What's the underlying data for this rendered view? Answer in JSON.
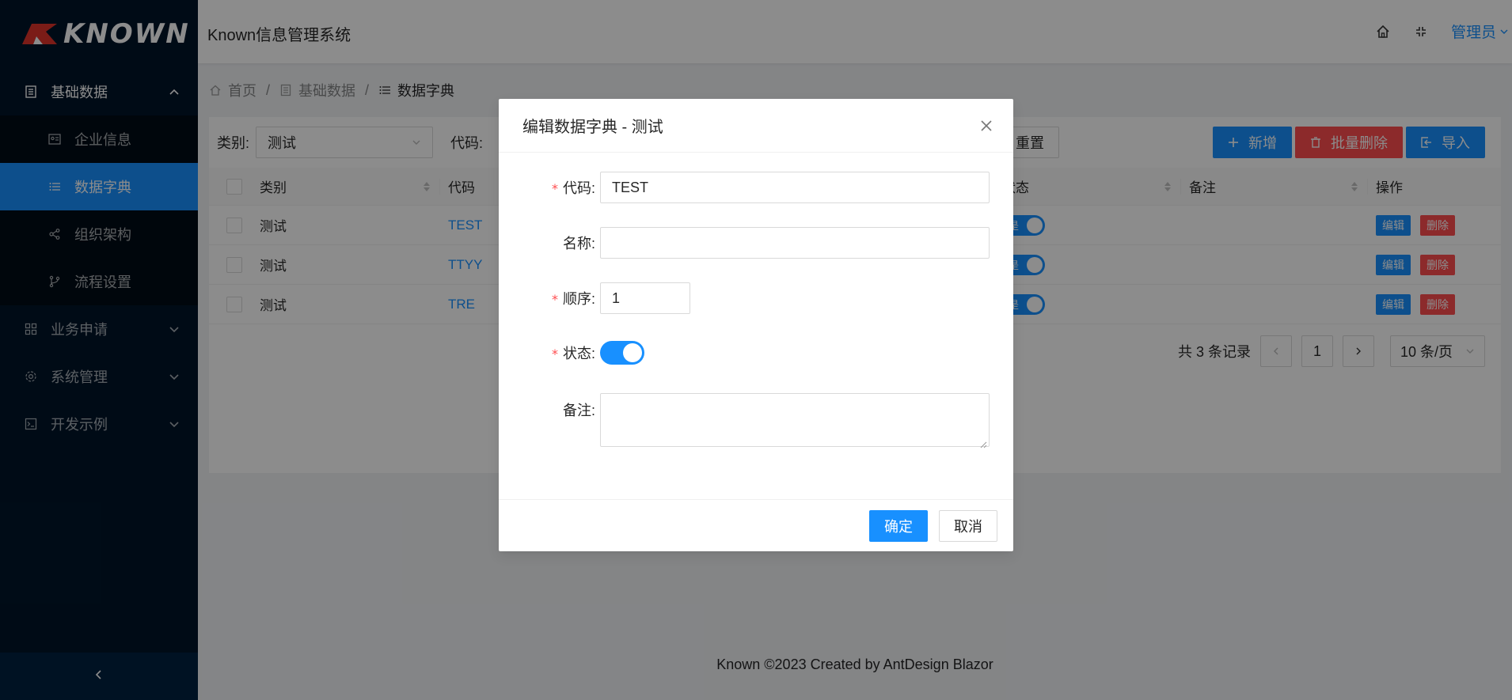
{
  "app": {
    "logo_text": "KNOWN",
    "title": "Known信息管理系统",
    "user": "管理员",
    "footer": "Known ©2023 Created by AntDesign Blazor"
  },
  "sidebar": {
    "groups": [
      {
        "label": "基础数据",
        "icon": "database-icon",
        "open": true,
        "items": [
          {
            "label": "企业信息",
            "icon": "idcard-icon"
          },
          {
            "label": "数据字典",
            "icon": "unordered-list-icon",
            "selected": true
          },
          {
            "label": "组织架构",
            "icon": "partition-icon"
          },
          {
            "label": "流程设置",
            "icon": "branches-icon"
          }
        ]
      },
      {
        "label": "业务申请",
        "icon": "appstore-icon"
      },
      {
        "label": "系统管理",
        "icon": "setting-icon"
      },
      {
        "label": "开发示例",
        "icon": "code-icon"
      }
    ]
  },
  "breadcrumb": {
    "home": "首页",
    "section": "基础数据",
    "current": "数据字典"
  },
  "toolbar": {
    "category_label": "类别:",
    "category_value": "测试",
    "code_label": "代码:",
    "reset": "重置",
    "add": "新增",
    "batch_delete": "批量删除",
    "import": "导入"
  },
  "table": {
    "columns": [
      "类别",
      "代码",
      "状态",
      "备注",
      "操作"
    ],
    "rows": [
      {
        "type": "测试",
        "code": "TEST",
        "status": "是"
      },
      {
        "type": "测试",
        "code": "TTYY",
        "status": "是"
      },
      {
        "type": "测试",
        "code": "TRE",
        "status": "是"
      }
    ],
    "edit_label": "编辑",
    "delete_label": "删除"
  },
  "pagination": {
    "total": "共 3 条记录",
    "current_page": "1",
    "page_size": "10 条/页"
  },
  "modal": {
    "title": "编辑数据字典 - 测试",
    "fields": {
      "code_label": "代码:",
      "code_value": "TEST",
      "name_label": "名称:",
      "name_value": "",
      "order_label": "顺序:",
      "order_value": "1",
      "status_label": "状态:",
      "status_on": true,
      "remark_label": "备注:",
      "remark_value": ""
    },
    "ok": "确定",
    "cancel": "取消"
  },
  "colors": {
    "primary": "#1890ff",
    "danger": "#ff4d4f",
    "sider": "#001529"
  }
}
